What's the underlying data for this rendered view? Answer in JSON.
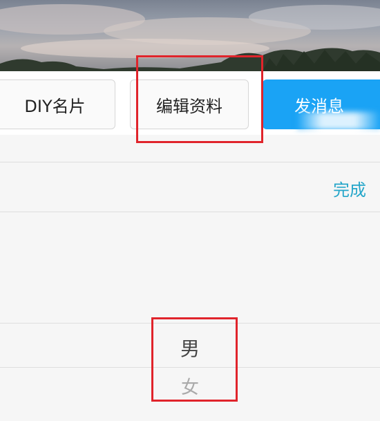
{
  "buttons": {
    "diy_label": "DIY名片",
    "edit_label": "编辑资料",
    "message_label": "发消息"
  },
  "toolbar": {
    "done_label": "完成"
  },
  "gender_picker": {
    "options": [
      "男",
      "女"
    ],
    "selected": "男"
  },
  "colors": {
    "accent_blue": "#1aa3f5",
    "done_teal": "#25a6c9",
    "highlight_red": "#e0242b"
  }
}
